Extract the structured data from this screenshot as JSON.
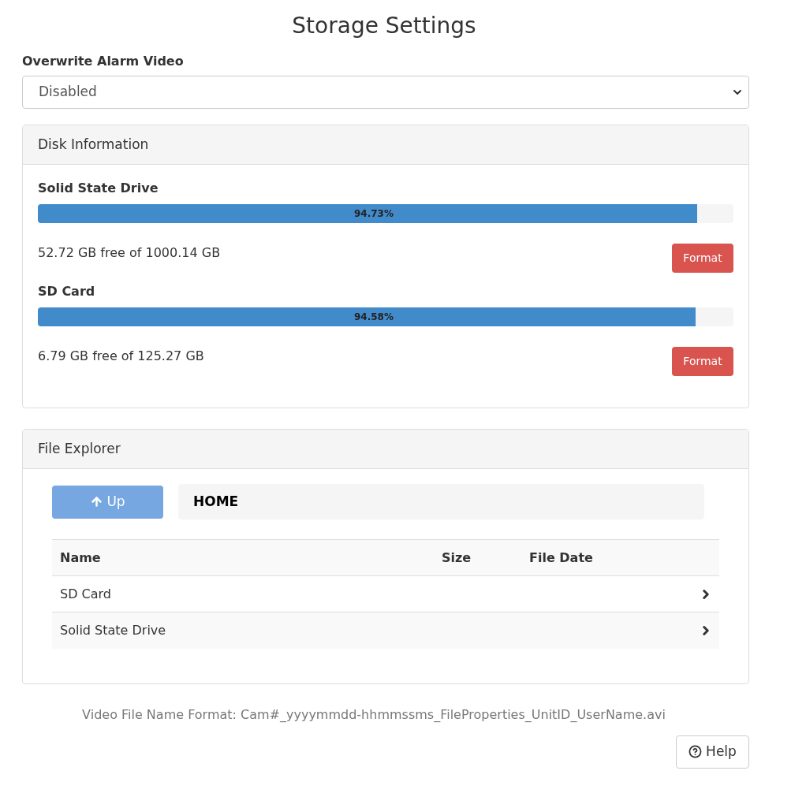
{
  "title": "Storage Settings",
  "overwrite": {
    "label": "Overwrite Alarm Video",
    "value": "Disabled"
  },
  "disk_panel": {
    "title": "Disk Information",
    "drives": [
      {
        "name": "Solid State Drive",
        "level": 0.9473,
        "reading": "94.73%",
        "free": "52.72 GB free of 1000.14 GB",
        "button": "Format"
      },
      {
        "name": "SD Card",
        "level": 0.9458,
        "reading": "94.58%",
        "free": "6.79 GB free of 125.27 GB",
        "button": "Format"
      }
    ]
  },
  "file_explorer": {
    "title": "File Explorer",
    "up_button": {
      "label": "Up",
      "disabled": true
    },
    "path": "HOME",
    "columns": [
      "Name",
      "Size",
      "File Date"
    ],
    "rows": [
      {
        "name": "SD Card"
      },
      {
        "name": "Solid State Drive"
      }
    ]
  },
  "footer_note": "Video File Name Format: Cam#_yyyymmdd-hhmmssms_FileProperties_UnitID_UserName.avi",
  "help_button": "Help"
}
